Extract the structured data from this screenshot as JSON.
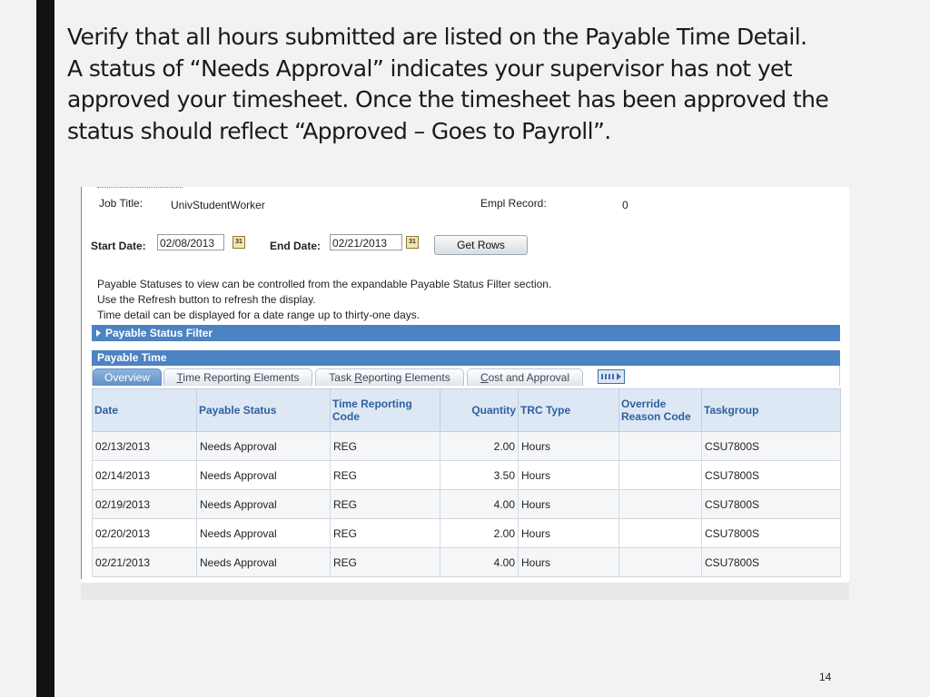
{
  "caption": {
    "lines": [
      "Verify that all hours submitted are listed on the Payable Time Detail.",
      "A status of “Needs Approval” indicates your supervisor has not yet",
      "approved your timesheet. Once the timesheet has been approved the",
      "status should reflect “Approved – Goes to Payroll”."
    ]
  },
  "header": {
    "job_title_label": "Job Title:",
    "job_title_value": "UnivStudentWorker",
    "empl_record_label": "Empl Record:",
    "empl_record_value": "0"
  },
  "dates": {
    "start_label": "Start Date:",
    "start_value": "02/08/2013",
    "end_label": "End Date:",
    "end_value": "02/21/2013",
    "calendar_icon_glyph": "31",
    "get_rows_label": "Get Rows"
  },
  "info": {
    "lines": [
      "Payable Statuses to view can be controlled from the expandable Payable Status Filter section.",
      "Use the Refresh button to refresh the display.",
      "Time detail can be displayed for a date range up to thirty-one days."
    ]
  },
  "filter": {
    "label": "Payable Status Filter"
  },
  "payable_time": {
    "title": "Payable Time",
    "tabs": [
      {
        "pre": "",
        "ul": "",
        "post": "Overview",
        "active": true
      },
      {
        "pre": "",
        "ul": "T",
        "post": "ime Reporting Elements",
        "active": false
      },
      {
        "pre": "Task ",
        "ul": "R",
        "post": "eporting Elements",
        "active": false
      },
      {
        "pre": "",
        "ul": "C",
        "post": "ost and Approval",
        "active": false
      }
    ],
    "columns": [
      "Date",
      "Payable Status",
      "Time Reporting Code",
      "Quantity",
      "TRC Type",
      "Override Reason Code",
      "Taskgroup"
    ],
    "rows": [
      {
        "date": "02/13/2013",
        "status": "Needs Approval",
        "trc": "REG",
        "quantity": "2.00",
        "trc_type": "Hours",
        "override": "",
        "taskgroup": "CSU7800S"
      },
      {
        "date": "02/14/2013",
        "status": "Needs Approval",
        "trc": "REG",
        "quantity": "3.50",
        "trc_type": "Hours",
        "override": "",
        "taskgroup": "CSU7800S"
      },
      {
        "date": "02/19/2013",
        "status": "Needs Approval",
        "trc": "REG",
        "quantity": "4.00",
        "trc_type": "Hours",
        "override": "",
        "taskgroup": "CSU7800S"
      },
      {
        "date": "02/20/2013",
        "status": "Needs Approval",
        "trc": "REG",
        "quantity": "2.00",
        "trc_type": "Hours",
        "override": "",
        "taskgroup": "CSU7800S"
      },
      {
        "date": "02/21/2013",
        "status": "Needs Approval",
        "trc": "REG",
        "quantity": "4.00",
        "trc_type": "Hours",
        "override": "",
        "taskgroup": "CSU7800S"
      }
    ]
  },
  "page_number": "14",
  "colors": {
    "accent_bar": "#4c83c2",
    "header_text": "#2f5fa0",
    "side_bar": "#111111"
  }
}
